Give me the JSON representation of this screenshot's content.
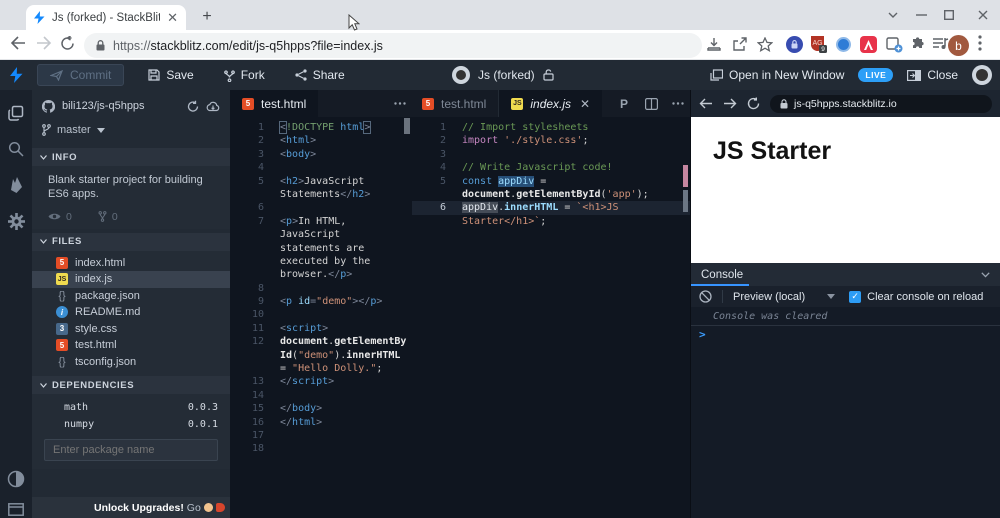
{
  "browser": {
    "tab_title": "Js (forked) - StackBlitz",
    "url_scheme": "https://",
    "url_rest": "stackblitz.com/edit/js-q5hpps?file=index.js",
    "ext_badge": "9",
    "profile_initial": "b"
  },
  "header": {
    "commit": "Commit",
    "save": "Save",
    "fork": "Fork",
    "share": "Share",
    "project": "Js (forked)",
    "open_new_window": "Open in New Window",
    "live": "LIVE",
    "close": "Close"
  },
  "sidebar": {
    "repo": "bili123/js-q5hpps",
    "branch": "master",
    "info_title": "INFO",
    "description": "Blank starter project for building ES6 apps.",
    "watchers": "0",
    "forks": "0",
    "files_title": "FILES",
    "files": [
      {
        "name": "index.html",
        "icon": "html",
        "glyph": "5"
      },
      {
        "name": "index.js",
        "icon": "js",
        "glyph": "JS",
        "selected": true
      },
      {
        "name": "package.json",
        "icon": "json",
        "glyph": "{}"
      },
      {
        "name": "README.md",
        "icon": "info",
        "glyph": "i"
      },
      {
        "name": "style.css",
        "icon": "css",
        "glyph": "3"
      },
      {
        "name": "test.html",
        "icon": "html",
        "glyph": "5"
      },
      {
        "name": "tsconfig.json",
        "icon": "json",
        "glyph": "{}"
      }
    ],
    "deps_title": "DEPENDENCIES",
    "deps": [
      {
        "name": "math",
        "version": "0.0.3"
      },
      {
        "name": "numpy",
        "version": "0.0.1"
      }
    ],
    "package_placeholder": "Enter package name",
    "upgrade_bold": "Unlock Upgrades!",
    "upgrade_rest": "Go"
  },
  "editor_left": {
    "tab": "test.html",
    "rows": [
      {
        "n": "1",
        "s": [
          [
            "<",
            "pm"
          ],
          [
            "!DOCTYPE",
            "d"
          ],
          [
            " ",
            "w"
          ],
          [
            "html",
            "t"
          ],
          [
            ">",
            "pm"
          ]
        ]
      },
      {
        "n": "2",
        "s": [
          [
            "<",
            "p"
          ],
          [
            "html",
            "t"
          ],
          [
            ">",
            "p"
          ]
        ]
      },
      {
        "n": "3",
        "s": [
          [
            "<",
            "p"
          ],
          [
            "body",
            "t"
          ],
          [
            ">",
            "p"
          ]
        ]
      },
      {
        "n": "4",
        "s": []
      },
      {
        "n": "5",
        "s": [
          [
            "<",
            "p"
          ],
          [
            "h2",
            "t"
          ],
          [
            ">",
            "p"
          ],
          [
            "JavaScript",
            "w"
          ]
        ]
      },
      {
        "n": "",
        "s": [
          [
            "Statements",
            "w"
          ],
          [
            "</",
            "p"
          ],
          [
            "h2",
            "t"
          ],
          [
            ">",
            "p"
          ]
        ]
      },
      {
        "n": "6",
        "s": []
      },
      {
        "n": "7",
        "s": [
          [
            "<",
            "p"
          ],
          [
            "p",
            "t"
          ],
          [
            ">",
            "p"
          ],
          [
            "In HTML,",
            "w"
          ]
        ]
      },
      {
        "n": "",
        "s": [
          [
            "JavaScript",
            "w"
          ]
        ]
      },
      {
        "n": "",
        "s": [
          [
            "statements are",
            "w"
          ]
        ]
      },
      {
        "n": "",
        "s": [
          [
            "executed by the",
            "w"
          ]
        ]
      },
      {
        "n": "",
        "s": [
          [
            "browser.",
            "w"
          ],
          [
            "</",
            "p"
          ],
          [
            "p",
            "t"
          ],
          [
            ">",
            "p"
          ]
        ]
      },
      {
        "n": "8",
        "s": []
      },
      {
        "n": "9",
        "s": [
          [
            "<",
            "p"
          ],
          [
            "p",
            "t"
          ],
          [
            " ",
            "w"
          ],
          [
            "id",
            "a"
          ],
          [
            "=",
            "p"
          ],
          [
            "\"demo\"",
            "s"
          ],
          [
            ">",
            "p"
          ],
          [
            "</",
            "p"
          ],
          [
            "p",
            "t"
          ],
          [
            ">",
            "p"
          ]
        ]
      },
      {
        "n": "10",
        "s": []
      },
      {
        "n": "11",
        "s": [
          [
            "<",
            "p"
          ],
          [
            "script",
            "t"
          ],
          [
            ">",
            "p"
          ]
        ]
      },
      {
        "n": "12",
        "s": [
          [
            "document",
            "b"
          ],
          [
            ".",
            "w"
          ],
          [
            "getElementBy",
            "b"
          ]
        ]
      },
      {
        "n": "",
        "s": [
          [
            "Id",
            "b"
          ],
          [
            "(",
            "w"
          ],
          [
            "\"demo\"",
            "s"
          ],
          [
            ")",
            "w"
          ],
          [
            ".",
            "w"
          ],
          [
            "innerHTML",
            "b"
          ]
        ]
      },
      {
        "n": "",
        "s": [
          [
            "= ",
            "w"
          ],
          [
            "\"Hello Dolly.\"",
            "s"
          ],
          [
            ";",
            "w"
          ]
        ]
      },
      {
        "n": "13",
        "s": [
          [
            "</",
            "p"
          ],
          [
            "script",
            "t"
          ],
          [
            ">",
            "p"
          ]
        ]
      },
      {
        "n": "14",
        "s": []
      },
      {
        "n": "15",
        "s": [
          [
            "</",
            "p"
          ],
          [
            "body",
            "t"
          ],
          [
            ">",
            "p"
          ]
        ]
      },
      {
        "n": "16",
        "s": [
          [
            "</",
            "p"
          ],
          [
            "html",
            "t"
          ],
          [
            ">",
            "p"
          ]
        ]
      },
      {
        "n": "17",
        "s": []
      },
      {
        "n": "18",
        "s": []
      }
    ]
  },
  "editor_right": {
    "tab_inactive": "test.html",
    "tab_active": "index.js",
    "rows": [
      {
        "n": "1",
        "s": [
          [
            "// Import stylesheets",
            "c"
          ]
        ]
      },
      {
        "n": "2",
        "s": [
          [
            "import",
            "k"
          ],
          [
            " ",
            "w"
          ],
          [
            "'./style.css'",
            "s"
          ],
          [
            ";",
            "w"
          ]
        ]
      },
      {
        "n": "3",
        "s": []
      },
      {
        "n": "4",
        "s": [
          [
            "// Write Javascript code!",
            "c"
          ]
        ]
      },
      {
        "n": "5",
        "s": [
          [
            "const",
            "t"
          ],
          [
            " ",
            "w"
          ],
          [
            "appDiv",
            "hb"
          ],
          [
            " =",
            "w"
          ]
        ]
      },
      {
        "n": "",
        "s": [
          [
            "document",
            "b"
          ],
          [
            ".",
            "w"
          ],
          [
            "getElementById",
            "b"
          ],
          [
            "(",
            "w"
          ],
          [
            "'app'",
            "s"
          ],
          [
            ")",
            "w"
          ],
          [
            ";",
            "w"
          ]
        ]
      },
      {
        "n": "6",
        "cur": true,
        "s": [
          [
            "appDiv",
            "hg"
          ],
          [
            ".",
            "w"
          ],
          [
            "innerHTML",
            "ib"
          ],
          [
            " = ",
            "w"
          ],
          [
            "`<h1>JS",
            "s"
          ]
        ]
      },
      {
        "n": "",
        "s": [
          [
            "Starter</h1>`",
            "s"
          ],
          [
            ";",
            "w"
          ]
        ]
      }
    ]
  },
  "preview": {
    "url": "js-q5hpps.stackblitz.io",
    "heading": "JS Starter",
    "console_title": "Console",
    "target": "Preview (local)",
    "clear_label": "Clear console on reload",
    "log": "Console was cleared"
  },
  "colors": {
    "accent_blue": "#2d9ff7",
    "live_badge": "#2d9ff7",
    "console_underline": "#3794ff",
    "selection_blue": "#264f78",
    "string_orange": "#ce9178",
    "tag_blue": "#569cd6",
    "comment_green": "#6a9955"
  }
}
